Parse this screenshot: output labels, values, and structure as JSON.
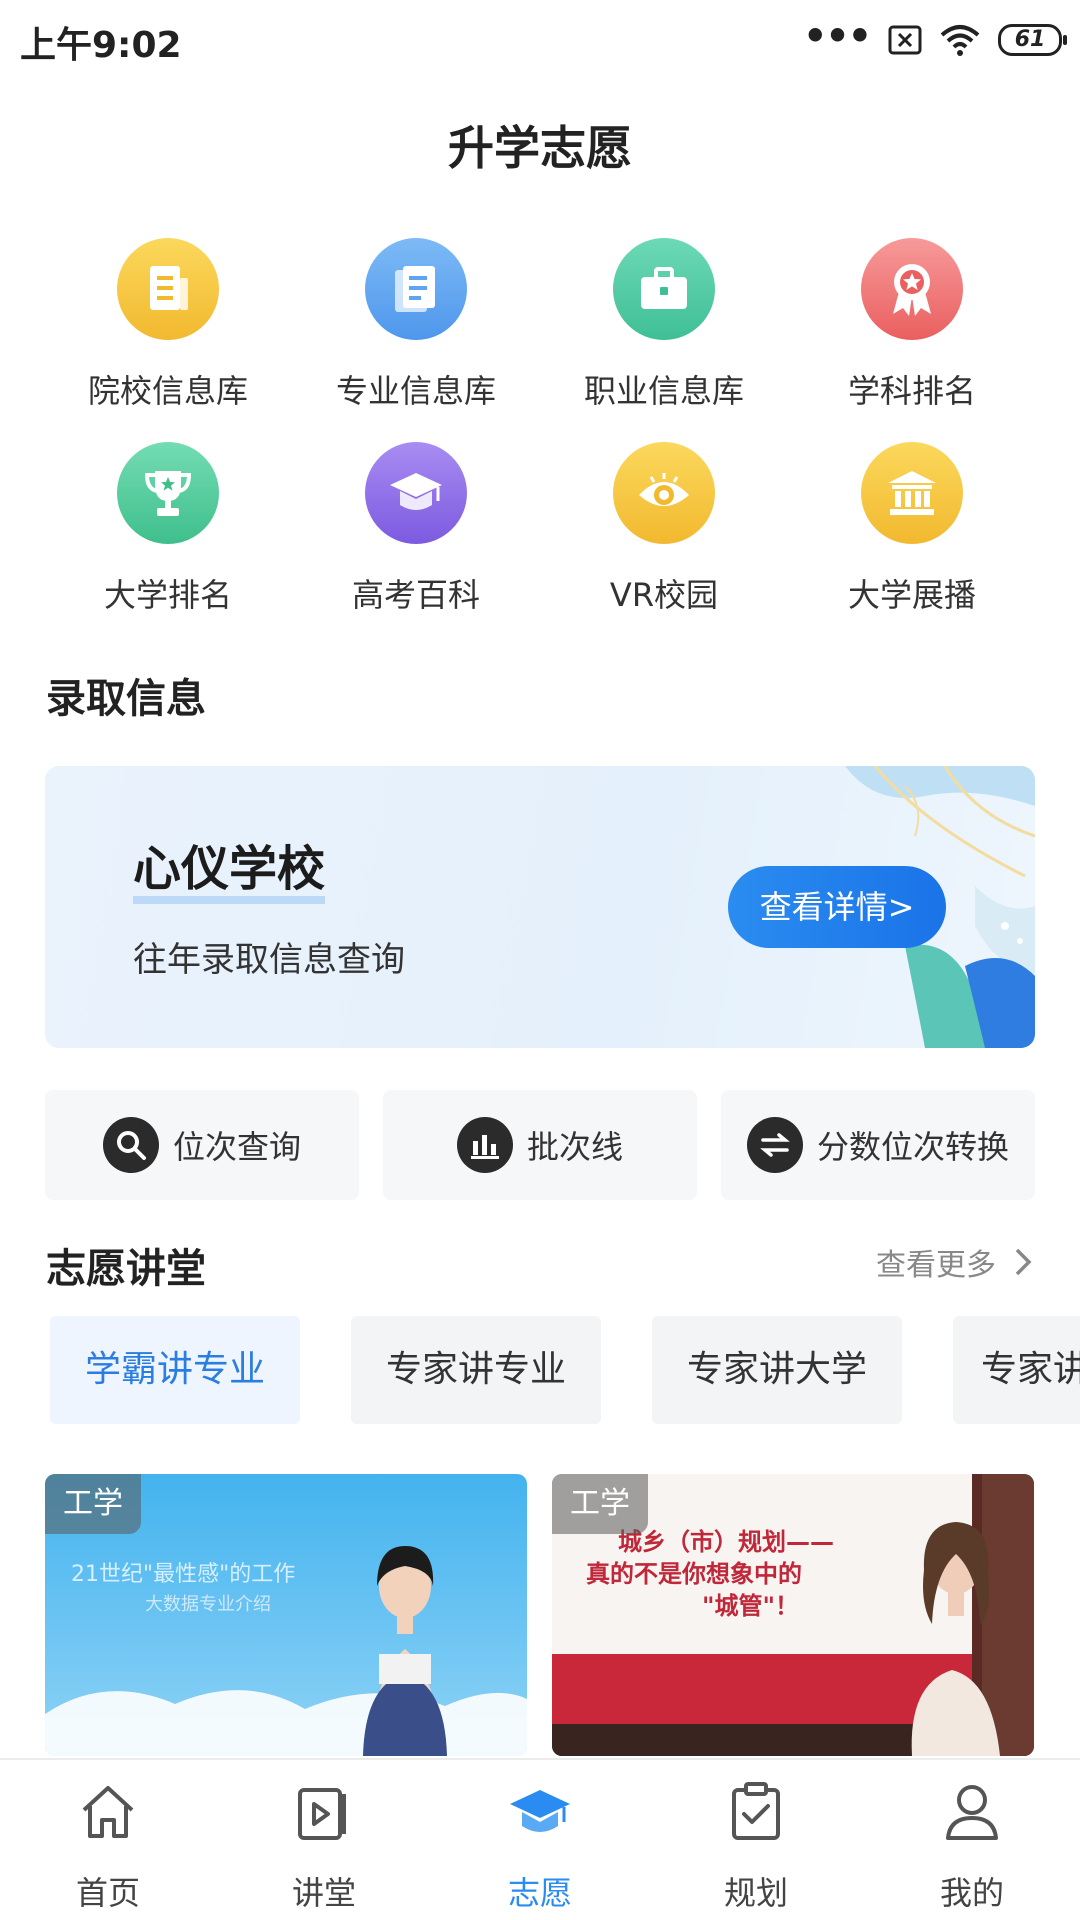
{
  "status_bar": {
    "time": "上午9:02",
    "dots": "•••",
    "battery": "61"
  },
  "page_title": "升学志愿",
  "grid": [
    {
      "label": "院校信息库",
      "icon": "document-icon",
      "color": "#f5c542"
    },
    {
      "label": "专业信息库",
      "icon": "notes-icon",
      "color": "#5ea4f2"
    },
    {
      "label": "职业信息库",
      "icon": "briefcase-icon",
      "color": "#4cc7a2"
    },
    {
      "label": "学科排名",
      "icon": "award-ribbon-icon",
      "color": "#f06e6e"
    },
    {
      "label": "大学排名",
      "icon": "trophy-icon",
      "color": "#52c79a"
    },
    {
      "label": "高考百科",
      "icon": "graduation-cap-icon",
      "color": "#8f6ee8"
    },
    {
      "label": "VR校园",
      "icon": "eye-icon",
      "color": "#f5c542"
    },
    {
      "label": "大学展播",
      "icon": "university-building-icon",
      "color": "#f5c542"
    }
  ],
  "admission": {
    "section_title": "录取信息",
    "banner_title": "心仪学校",
    "banner_subtitle": "往年录取信息查询",
    "banner_button": "查看详情>"
  },
  "quick_buttons": [
    {
      "label": "位次查询",
      "icon": "search-icon"
    },
    {
      "label": "批次线",
      "icon": "bar-chart-icon"
    },
    {
      "label": "分数位次转换",
      "icon": "swap-icon"
    }
  ],
  "lecture": {
    "section_title": "志愿讲堂",
    "more": "查看更多",
    "tabs": [
      "学霸讲专业",
      "专家讲专业",
      "专家讲大学",
      "专家讲"
    ],
    "active_tab": 0,
    "cards": [
      {
        "tag": "工学",
        "screen_text": "21世纪\"最性感\"的工作",
        "screen_sub": "大数据专业介绍"
      },
      {
        "tag": "工学",
        "screen_text": "城乡（市）规划——",
        "screen_text2": "真的不是你想象中的",
        "screen_text3": "\"城管\"！"
      }
    ]
  },
  "bottom_nav": [
    {
      "label": "首页",
      "icon": "home-icon"
    },
    {
      "label": "讲堂",
      "icon": "video-play-icon"
    },
    {
      "label": "志愿",
      "icon": "graduation-cap-icon"
    },
    {
      "label": "规划",
      "icon": "clipboard-check-icon"
    },
    {
      "label": "我的",
      "icon": "user-icon"
    }
  ],
  "colors": {
    "accent": "#2a8cf0",
    "active_tab_text": "#2a7de1"
  }
}
